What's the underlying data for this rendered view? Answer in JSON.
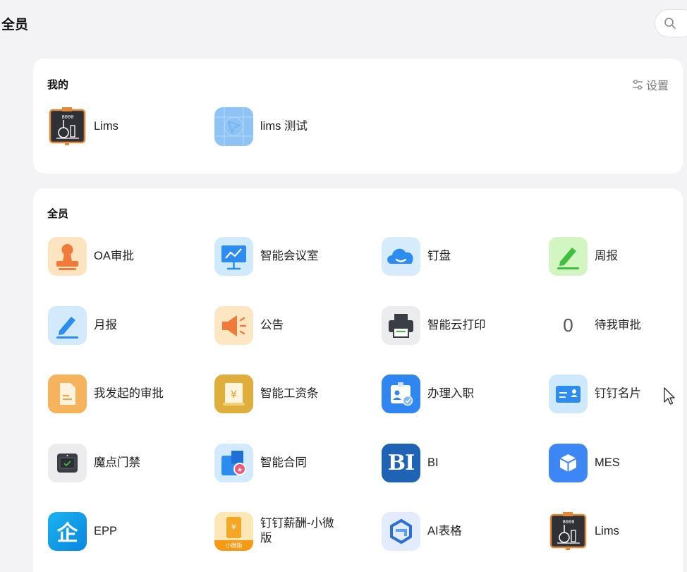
{
  "header": {
    "title": "全员"
  },
  "mine": {
    "title": "我的",
    "settings_label": "设置",
    "apps": [
      {
        "label": "Lims",
        "icon": "lims-icon"
      },
      {
        "label": "lims 测试",
        "icon": "lims-test-icon"
      }
    ]
  },
  "all": {
    "title": "全员",
    "apps": [
      {
        "label": "OA审批",
        "icon": "stamp-icon"
      },
      {
        "label": "智能会议室",
        "icon": "meeting-room-icon"
      },
      {
        "label": "钉盘",
        "icon": "cloud-icon"
      },
      {
        "label": "周报",
        "icon": "pen-green-icon"
      },
      {
        "label": "月报",
        "icon": "pen-blue-icon"
      },
      {
        "label": "公告",
        "icon": "megaphone-icon"
      },
      {
        "label": "智能云打印",
        "icon": "printer-icon"
      },
      {
        "label": "待我审批",
        "icon": "zero-count",
        "count": "0"
      },
      {
        "label": "我发起的审批",
        "icon": "document-icon"
      },
      {
        "label": "智能工资条",
        "icon": "salary-slip-icon"
      },
      {
        "label": "办理入职",
        "icon": "onboarding-icon"
      },
      {
        "label": "钉钉名片",
        "icon": "business-card-icon"
      },
      {
        "label": "魔点门禁",
        "icon": "door-access-icon"
      },
      {
        "label": "智能合同",
        "icon": "contract-icon"
      },
      {
        "label": "BI",
        "icon": "bi-icon",
        "icon_text": "BI"
      },
      {
        "label": "MES",
        "icon": "cube-icon"
      },
      {
        "label": "EPP",
        "icon": "epp-icon",
        "icon_text": "企"
      },
      {
        "label": "钉钉薪酬-小微版",
        "icon": "payroll-icon",
        "badge": "小微版"
      },
      {
        "label": "AI表格",
        "icon": "ai-table-icon"
      },
      {
        "label": "Lims",
        "icon": "lims-icon"
      }
    ]
  },
  "colors": {
    "page_bg": "#f3f3f6",
    "card_bg": "#ffffff",
    "accent_blue": "#3d86f5"
  }
}
